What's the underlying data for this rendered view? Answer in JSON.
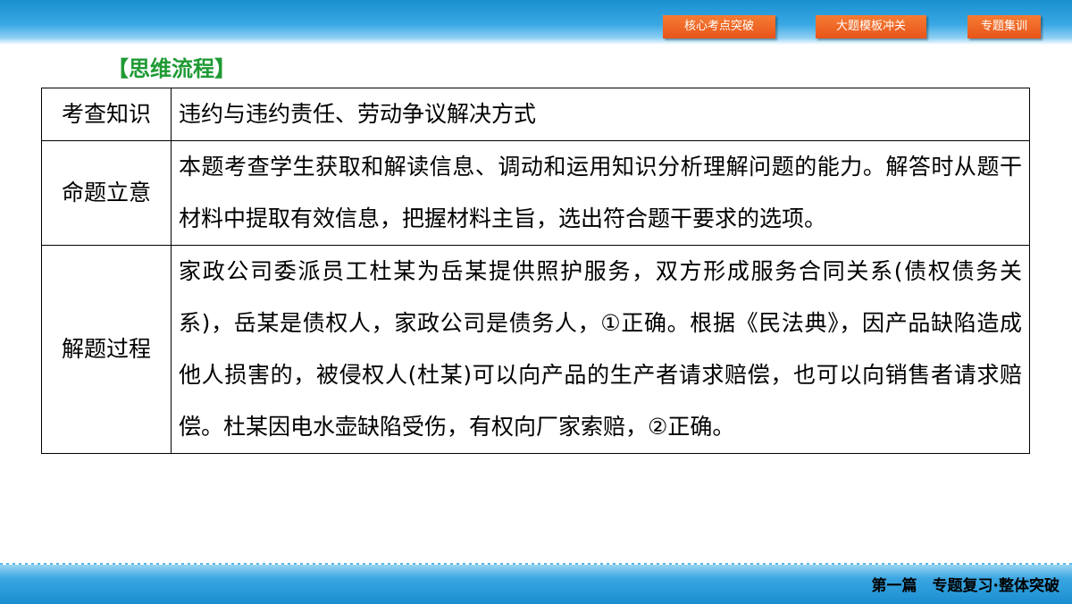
{
  "nav": {
    "btn1": "核心考点突破",
    "btn2": "大题模板冲关",
    "btn3": "专题集训"
  },
  "section_title": "【思维流程】",
  "table": {
    "row1": {
      "label": "考查知识",
      "content": "违约与违约责任、劳动争议解决方式"
    },
    "row2": {
      "label": "命题立意",
      "content": "本题考查学生获取和解读信息、调动和运用知识分析理解问题的能力。解答时从题干材料中提取有效信息，把握材料主旨，选出符合题干要求的选项。"
    },
    "row3": {
      "label": "解题过程",
      "content": "家政公司委派员工杜某为岳某提供照护服务，双方形成服务合同关系(债权债务关系)，岳某是债权人，家政公司是债务人，①正确。根据《民法典》，因产品缺陷造成他人损害的，被侵权人(杜某)可以向产品的生产者请求赔偿，也可以向销售者请求赔偿。杜某因电水壶缺陷受伤，有权向厂家索赔，②正确。"
    }
  },
  "footer": "第一篇　专题复习·整体突破",
  "colors": {
    "nav_orange": "#ee6a26",
    "title_green": "#1f9a34",
    "band_blue": "#1a8fd0"
  }
}
